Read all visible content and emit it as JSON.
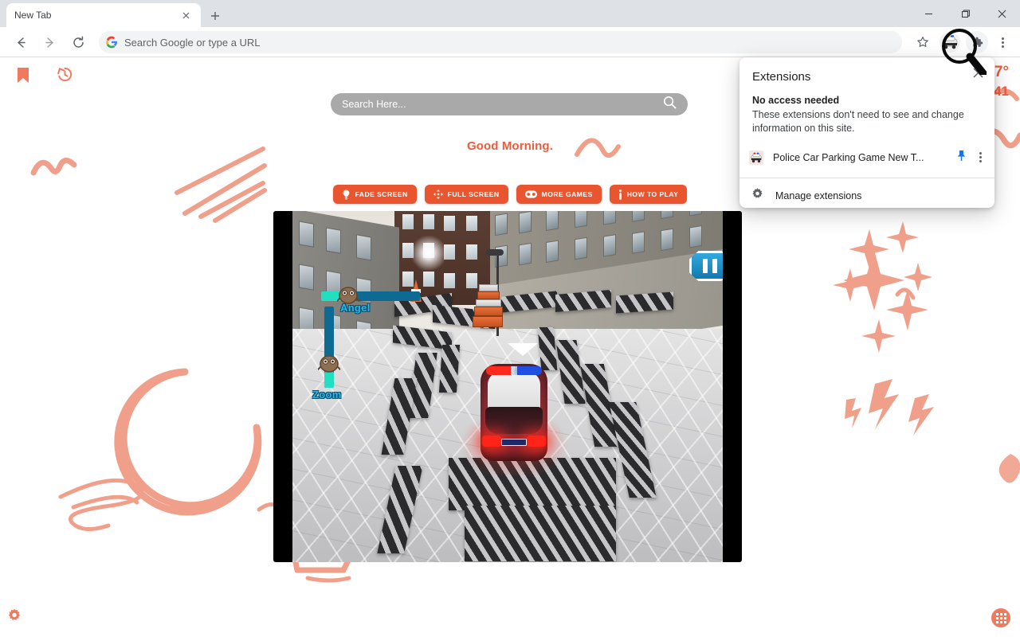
{
  "browser": {
    "tab": {
      "title": "New Tab",
      "close_icon": "close-icon"
    },
    "new_tab_icon": "plus-icon",
    "window_controls": {
      "minimize": "minimize-icon",
      "maximize": "maximize-icon",
      "close": "close-icon"
    },
    "nav": {
      "back": "back-arrow-icon",
      "forward": "forward-arrow-icon",
      "reload": "reload-icon"
    },
    "omnibox": {
      "placeholder": "Search Google or type a URL",
      "value": "",
      "logo": "google-g-icon"
    },
    "actions": {
      "bookmark_star": "star-icon",
      "extension_avatar": "police-car-extension-icon",
      "extensions_puzzle": "puzzle-piece-icon",
      "menu": "three-dot-menu-icon"
    }
  },
  "extensions_popup": {
    "title": "Extensions",
    "close_icon": "close-icon",
    "section_heading": "No access needed",
    "section_body": "These extensions don't need to see and change information on this site.",
    "items": [
      {
        "name": "Police Car Parking Game New T...",
        "icon": "police-car-extension-icon",
        "pin_icon": "pin-icon",
        "more_icon": "three-dot-menu-icon"
      }
    ],
    "manage": {
      "label": "Manage extensions",
      "icon": "gear-icon"
    }
  },
  "newtab": {
    "bookmark_icon": "bookmark-icon",
    "history_icon": "history-icon",
    "gear_icon": "gear-icon",
    "apps_icon": "apps-grid-icon",
    "weather": {
      "temperature": "7°",
      "low_high": "41"
    },
    "search": {
      "placeholder": "Search Here...",
      "value": "",
      "icon": "search-icon"
    },
    "greeting": "Good Morning.",
    "buttons": [
      {
        "label": "FADE SCREEN",
        "icon": "lightbulb-icon"
      },
      {
        "label": "FULL SCREEN",
        "icon": "expand-arrows-icon"
      },
      {
        "label": "MORE GAMES",
        "icon": "gamepad-icon"
      },
      {
        "label": "HOW TO PLAY",
        "icon": "info-icon"
      }
    ],
    "colors": {
      "accent": "#e8552f",
      "doodle": "#f0a08a",
      "greeting": "#ef5a3a",
      "weather": "#ef5a3a"
    }
  },
  "game": {
    "title": "Police Car Parking Game",
    "pause_button": {
      "icon": "pause-icon",
      "label": ""
    },
    "hud": [
      {
        "label": "Angel",
        "type": "slider-horizontal",
        "fill_percent": 22
      },
      {
        "label": "Zoom",
        "type": "slider-vertical",
        "fill_percent": 18
      }
    ],
    "scene": {
      "vehicle": "police-car",
      "environment": "city-street-parking-lot",
      "obstacles": "striped-concrete-barriers"
    }
  }
}
